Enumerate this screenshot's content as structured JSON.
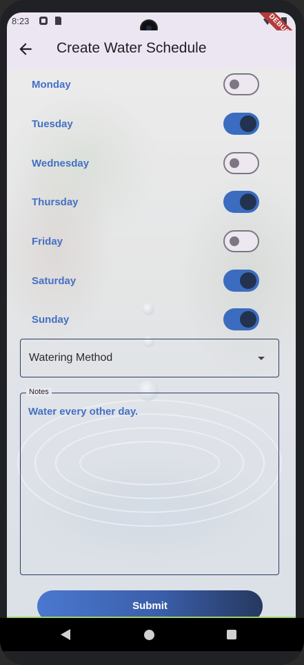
{
  "status_bar": {
    "time": "8:23",
    "debug_banner": "DEBUG"
  },
  "app_bar": {
    "title": "Create Water Schedule",
    "back_icon": "arrow-back-icon"
  },
  "days": [
    {
      "label": "Monday",
      "enabled": false
    },
    {
      "label": "Tuesday",
      "enabled": true
    },
    {
      "label": "Wednesday",
      "enabled": false
    },
    {
      "label": "Thursday",
      "enabled": true
    },
    {
      "label": "Friday",
      "enabled": false
    },
    {
      "label": "Saturday",
      "enabled": true
    },
    {
      "label": "Sunday",
      "enabled": true
    }
  ],
  "watering_method": {
    "label": "Watering Method",
    "icon": "arrow-drop-down-icon"
  },
  "notes": {
    "label": "Notes",
    "value": "Water every other day."
  },
  "submit": {
    "label": "Submit"
  },
  "colors": {
    "accent": "#3b6cc0",
    "day_label": "#4470c4",
    "thumb_on": "#22324f"
  }
}
